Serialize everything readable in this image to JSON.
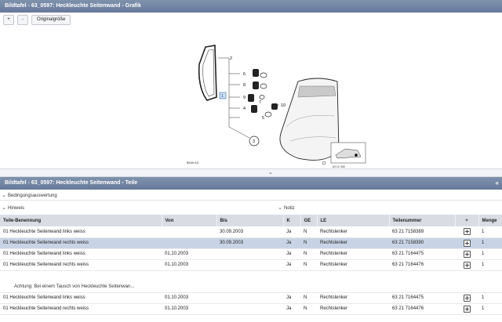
{
  "top_panel": {
    "title": "Bildtafel - 63_0597: Heckleuchte Seitenwand - Grafik",
    "toolbar": {
      "zoom_in": "+",
      "zoom_out": "-",
      "original_size": "Originalgröße"
    },
    "graphic": {
      "callouts": [
        "1",
        "2",
        "3",
        "4",
        "5",
        "6",
        "7",
        "8",
        "9",
        "10"
      ],
      "caption": "BMW AG",
      "inset_label": "63 12 038"
    }
  },
  "bottom_panel": {
    "title": "Bildtafel - 63_0597: Heckleuchte Seitenwand - Teile",
    "sections": {
      "bedingung": "Bedingungsauswertung",
      "hinweis": "Hinweis",
      "notiz": "Notiz"
    },
    "table": {
      "columns": [
        "Teile-Benennung",
        "Von",
        "Bis",
        "K",
        "GE",
        "LE",
        "Teilenummer",
        "+",
        "Menge"
      ],
      "rows": [
        {
          "name": "01 Heckleuchte Seitenwand links weiss",
          "von": "",
          "bis": "30.09.2003",
          "k": "Ja",
          "ge": "N",
          "le": "Rechtslenker",
          "nummer": "63 21 7158389",
          "menge": "1"
        },
        {
          "name": "01 Heckleuchte Seitenwand rechts weiss",
          "von": "",
          "bis": "30.09.2003",
          "k": "Ja",
          "ge": "N",
          "le": "Rechtslenker",
          "nummer": "63 21 7158390",
          "menge": "1"
        },
        {
          "name": "01 Heckleuchte Seitenwand links weiss",
          "von": "01.10.2003",
          "bis": "",
          "k": "Ja",
          "ge": "N",
          "le": "Rechtslenker",
          "nummer": "63 21 7164475",
          "menge": "1"
        },
        {
          "name": "01 Heckleuchte Seitenwand rechts weiss",
          "von": "01.10.2003",
          "bis": "",
          "k": "Ja",
          "ge": "N",
          "le": "Rechtslenker",
          "nummer": "63 21 7164476",
          "menge": "1"
        },
        {
          "name": "01 Heckleuchte Seitenwand links weiss",
          "von": "01.10.2003",
          "bis": "",
          "k": "Ja",
          "ge": "N",
          "le": "Rechtslenker",
          "nummer": "63 21 7164475",
          "menge": "1"
        },
        {
          "name": "01 Heckleuchte Seitenwand rechts weiss",
          "von": "01.10.2003",
          "bis": "",
          "k": "Ja",
          "ge": "N",
          "le": "Rechtslenker",
          "nummer": "63 21 7164476",
          "menge": "1"
        }
      ],
      "note": "Achtung: Bei einem Tausch von Heckleuchte Seitenwan...",
      "selected_row": 1
    }
  },
  "colors": {
    "header": "#6f82a1",
    "selected_row": "#c8d4e6",
    "table_header": "#d9dde3"
  }
}
